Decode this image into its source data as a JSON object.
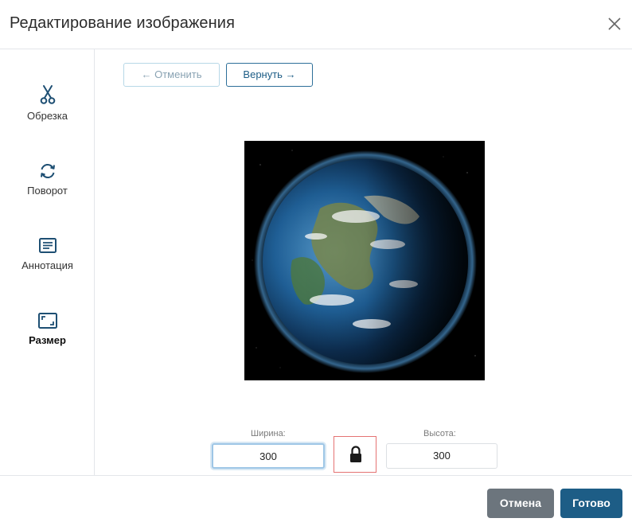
{
  "dialog": {
    "title": "Редактирование изображения"
  },
  "sidebar": {
    "items": [
      {
        "label": "Обрезка",
        "icon": "scissors-icon"
      },
      {
        "label": "Поворот",
        "icon": "rotate-icon"
      },
      {
        "label": "Аннотация",
        "icon": "annotation-icon"
      },
      {
        "label": "Размер",
        "icon": "resize-icon",
        "active": true
      }
    ]
  },
  "history": {
    "undo_label": "← Отменить",
    "redo_label": "Вернуть →"
  },
  "size": {
    "width_label": "Ширина:",
    "width_value": "300",
    "height_label": "Высота:",
    "height_value": "300",
    "lock_icon": "lock-icon"
  },
  "footer": {
    "cancel_label": "Отмена",
    "done_label": "Готово"
  },
  "colors": {
    "accent": "#1d5d86",
    "secondary_button": "#6c757d",
    "icon": "#1e4f73"
  }
}
